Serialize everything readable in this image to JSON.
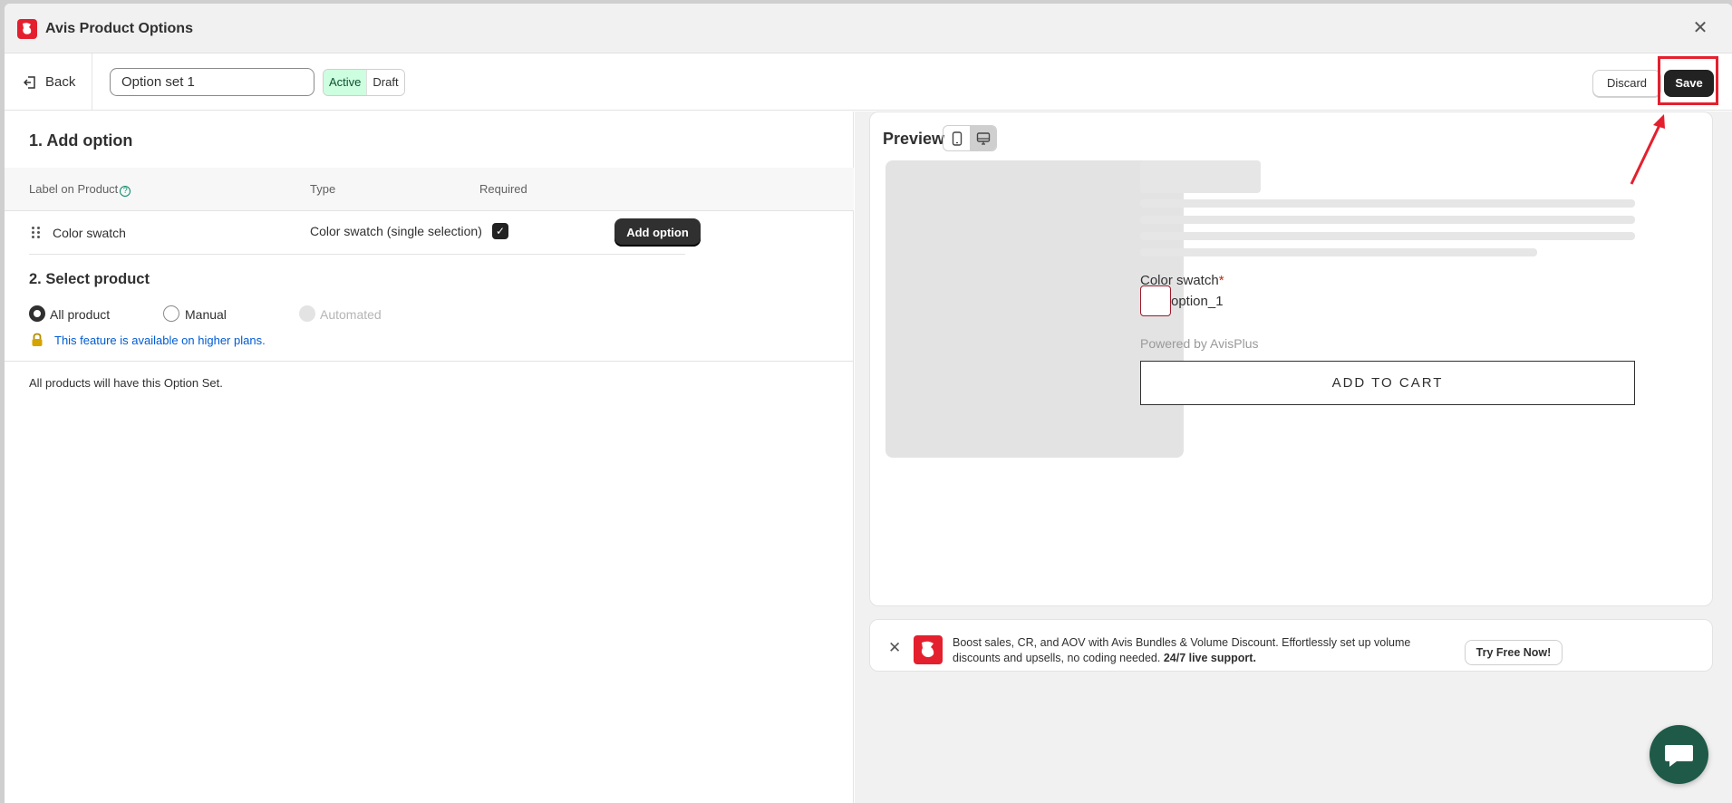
{
  "window": {
    "title": "Avis Product Options",
    "close_symbol": "✕"
  },
  "toolbar": {
    "back_label": "Back",
    "option_set_name": "Option set 1",
    "status_active": "Active",
    "status_draft": "Draft",
    "selected_status": "Active",
    "discard_label": "Discard",
    "save_label": "Save"
  },
  "add_option_section": {
    "title": "1. Add option",
    "columns": {
      "label": "Label on Product",
      "type": "Type",
      "required": "Required"
    },
    "rows": [
      {
        "label": "Color swatch",
        "type": "Color swatch (single selection)",
        "required": true
      }
    ],
    "add_button": "Add option"
  },
  "select_product_section": {
    "title": "2. Select product",
    "options": [
      {
        "label": "All product",
        "state": "checked"
      },
      {
        "label": "Manual",
        "state": "unchecked"
      },
      {
        "label": "Automated",
        "state": "disabled"
      }
    ],
    "upgrade_note": "This feature is available on higher plans.",
    "summary": "All products will have this Option Set."
  },
  "preview": {
    "title": "Preview",
    "device_selected": "desktop",
    "option_label": "Color swatch",
    "required_mark": "*",
    "swatch_value": "option_1",
    "powered_by": "Powered by AvisPlus",
    "add_to_cart": "ADD TO CART"
  },
  "promo": {
    "text_plain": "Boost sales, CR, and AOV with Avis Bundles & Volume Discount. Effortlessly set up volume discounts and upsells, no coding needed. ",
    "text_bold": "24/7 live support.",
    "button": "Try Free Now!"
  },
  "colors": {
    "brand_red": "#e4202e",
    "primary_button": "#303030",
    "active_badge": "#cdfedf",
    "link_blue": "#005bd3",
    "chat_green": "#1f5a48"
  }
}
